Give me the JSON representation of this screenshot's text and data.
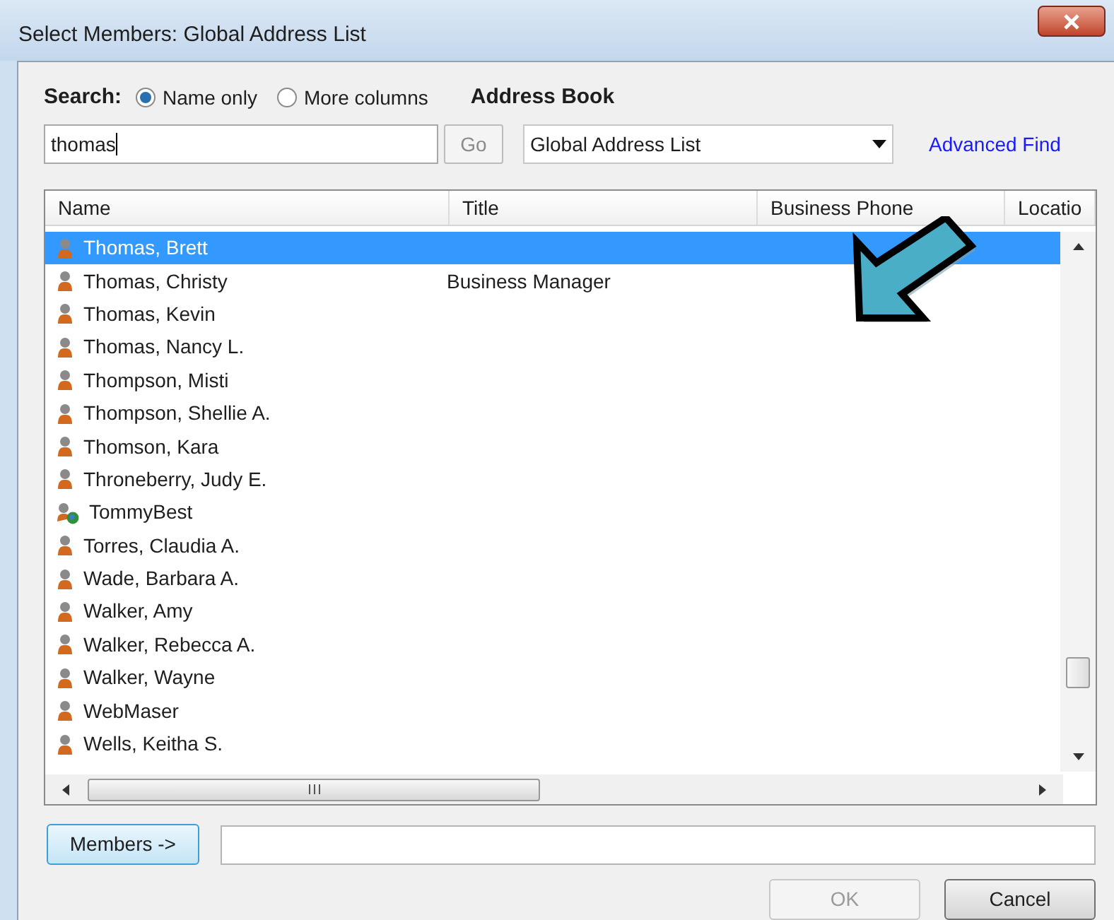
{
  "window": {
    "title": "Select Members: Global Address List"
  },
  "search": {
    "label": "Search:",
    "options": [
      {
        "label": "Name only",
        "selected": true
      },
      {
        "label": "More columns",
        "selected": false
      }
    ],
    "value": "thomas",
    "go": "Go"
  },
  "address_book": {
    "label": "Address Book",
    "value": "Global Address List",
    "advanced_find": "Advanced Find"
  },
  "table": {
    "columns": [
      "Name",
      "Title",
      "Business Phone",
      "Locatio"
    ],
    "rows": [
      {
        "name": "Thomas, Brett",
        "kind": "user",
        "selected": true
      },
      {
        "name": "Thomas, Christy",
        "title": "Business Manager",
        "kind": "user",
        "selected": false
      },
      {
        "name": "Thomas, Kevin",
        "kind": "user",
        "selected": false
      },
      {
        "name": "Thomas, Nancy L.",
        "kind": "user",
        "selected": false
      },
      {
        "name": "Thompson, Misti",
        "kind": "user",
        "selected": false
      },
      {
        "name": "Thompson, Shellie A.",
        "kind": "user",
        "selected": false
      },
      {
        "name": "Thomson, Kara",
        "kind": "user",
        "selected": false
      },
      {
        "name": "Throneberry, Judy E.",
        "kind": "user",
        "selected": false
      },
      {
        "name": "TommyBest",
        "kind": "external",
        "selected": false
      },
      {
        "name": "Torres, Claudia A.",
        "kind": "user",
        "selected": false
      },
      {
        "name": "Wade, Barbara A.",
        "kind": "user",
        "selected": false
      },
      {
        "name": "Walker, Amy",
        "kind": "user",
        "selected": false
      },
      {
        "name": "Walker, Rebecca A.",
        "kind": "user",
        "selected": false
      },
      {
        "name": "Walker, Wayne",
        "kind": "user",
        "selected": false
      },
      {
        "name": "WebMaser",
        "kind": "user",
        "selected": false
      },
      {
        "name": "Wells, Keitha S.",
        "kind": "user",
        "selected": false
      }
    ]
  },
  "members_button": "Members ->",
  "buttons": [
    {
      "label": "OK",
      "disabled": true
    },
    {
      "label": "Cancel",
      "disabled": false
    }
  ]
}
